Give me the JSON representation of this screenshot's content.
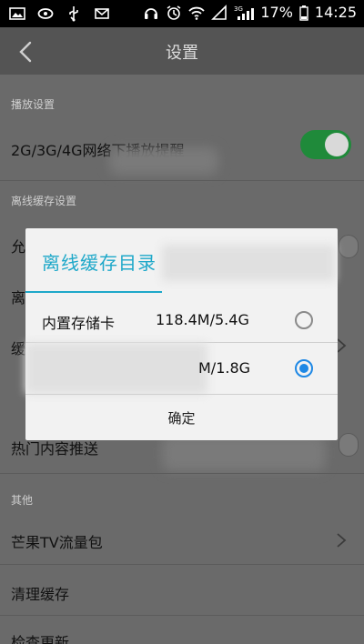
{
  "statusbar": {
    "left_icons": [
      "image-icon",
      "chat-icon",
      "usb-icon",
      "mail-icon"
    ],
    "right_icons": [
      "headphones-icon",
      "alarm-icon",
      "wifi-icon",
      "signal-empty-icon",
      "signal-3g-icon"
    ],
    "network_badge": "3G",
    "battery": "17%",
    "time": "14:25"
  },
  "appbar": {
    "title": "设置",
    "back_icon": "back-arrow-icon"
  },
  "settings": {
    "section_playback": "播放设置",
    "row_network_reminder": "2G/3G/4G网络下播放提醒",
    "network_reminder_on": true,
    "section_offline": "离线缓存设置",
    "row_allow_prefix": "允",
    "row_offline_dir_prefix": "离",
    "row_cache_prefix": "缓",
    "row_hot_content": "热门内容推送",
    "section_other": "其他",
    "row_traffic_pack": "芒果TV流量包",
    "row_clear_cache": "清理缓存",
    "row_check_update": "检查更新"
  },
  "dialog": {
    "title": "离线缓存目录",
    "options": [
      {
        "name": "内置存储卡",
        "size": "118.4M/5.4G",
        "selected": false
      },
      {
        "name": "",
        "size": "M/1.8G",
        "selected": true
      }
    ],
    "ok_label": "确定"
  },
  "colors": {
    "accent": "#1ea8c9",
    "toggle_on": "#1f8a3a",
    "radio_selected": "#1e88e5"
  }
}
